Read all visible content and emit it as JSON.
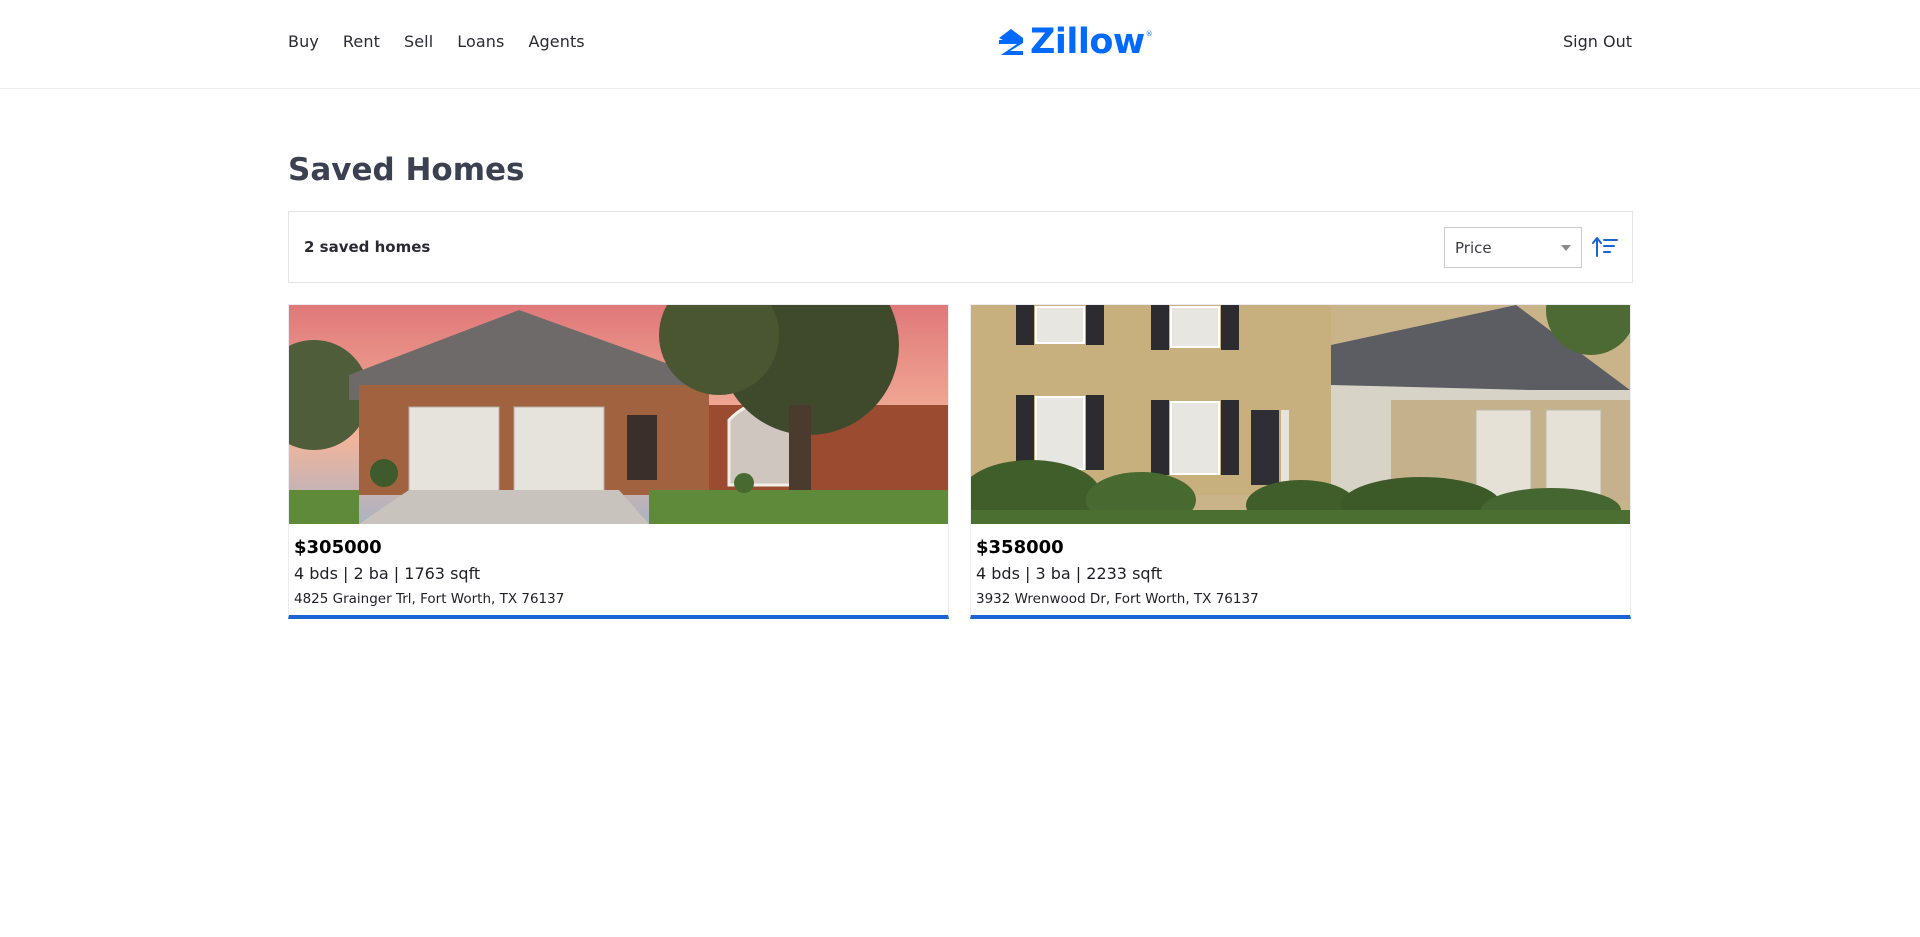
{
  "nav": {
    "items": [
      "Buy",
      "Rent",
      "Sell",
      "Loans",
      "Agents"
    ],
    "sign_out": "Sign Out"
  },
  "brand": {
    "name": "Zillow",
    "mark": "®",
    "color": "#006aff"
  },
  "page": {
    "title": "Saved Homes"
  },
  "toolbar": {
    "count_label": "2 saved homes",
    "sort_selected": "Price",
    "sort_order_icon": "sort-ascending-icon"
  },
  "homes": [
    {
      "price": "$305000",
      "specs": "4 bds | 2 ba | 1763 sqft",
      "address": "4825 Grainger Trl, Fort Worth, TX 76137"
    },
    {
      "price": "$358000",
      "specs": "4 bds | 3 ba | 2233 sqft",
      "address": "3932 Wrenwood Dr, Fort Worth, TX 76137"
    }
  ],
  "colors": {
    "accent": "#1a64d4",
    "title": "#3b4150"
  }
}
